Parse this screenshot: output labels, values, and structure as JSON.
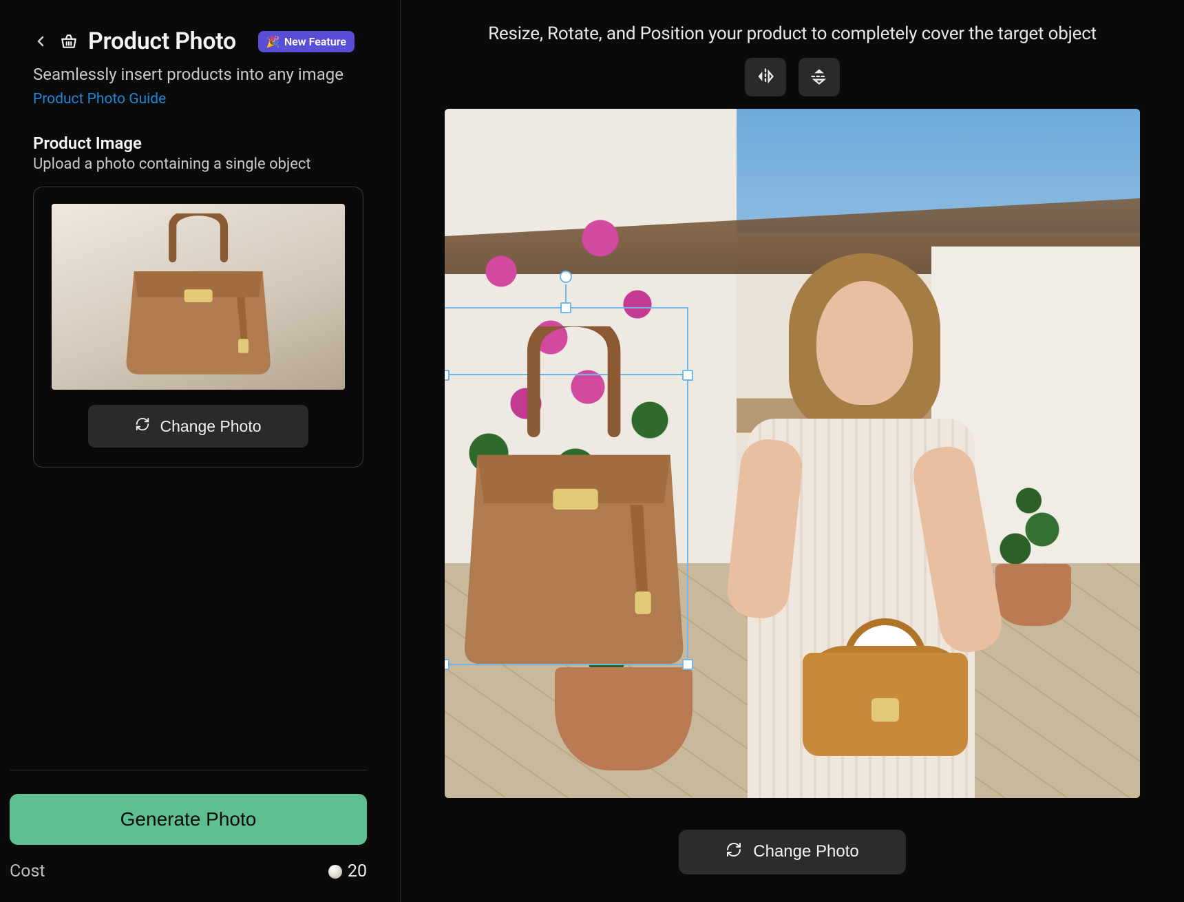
{
  "header": {
    "title": "Product Photo",
    "badge_label": "New Feature",
    "badge_emoji": "🎉",
    "subtitle": "Seamlessly insert products into any image",
    "guide_link": "Product Photo Guide"
  },
  "product_image": {
    "section_title": "Product Image",
    "section_desc": "Upload a photo containing a single object",
    "change_label": "Change Photo"
  },
  "footer": {
    "generate_label": "Generate Photo",
    "cost_label": "Cost",
    "cost_value": "20"
  },
  "canvas": {
    "instruction": "Resize, Rotate, and Position your product to completely cover the target object",
    "change_label": "Change Photo"
  }
}
